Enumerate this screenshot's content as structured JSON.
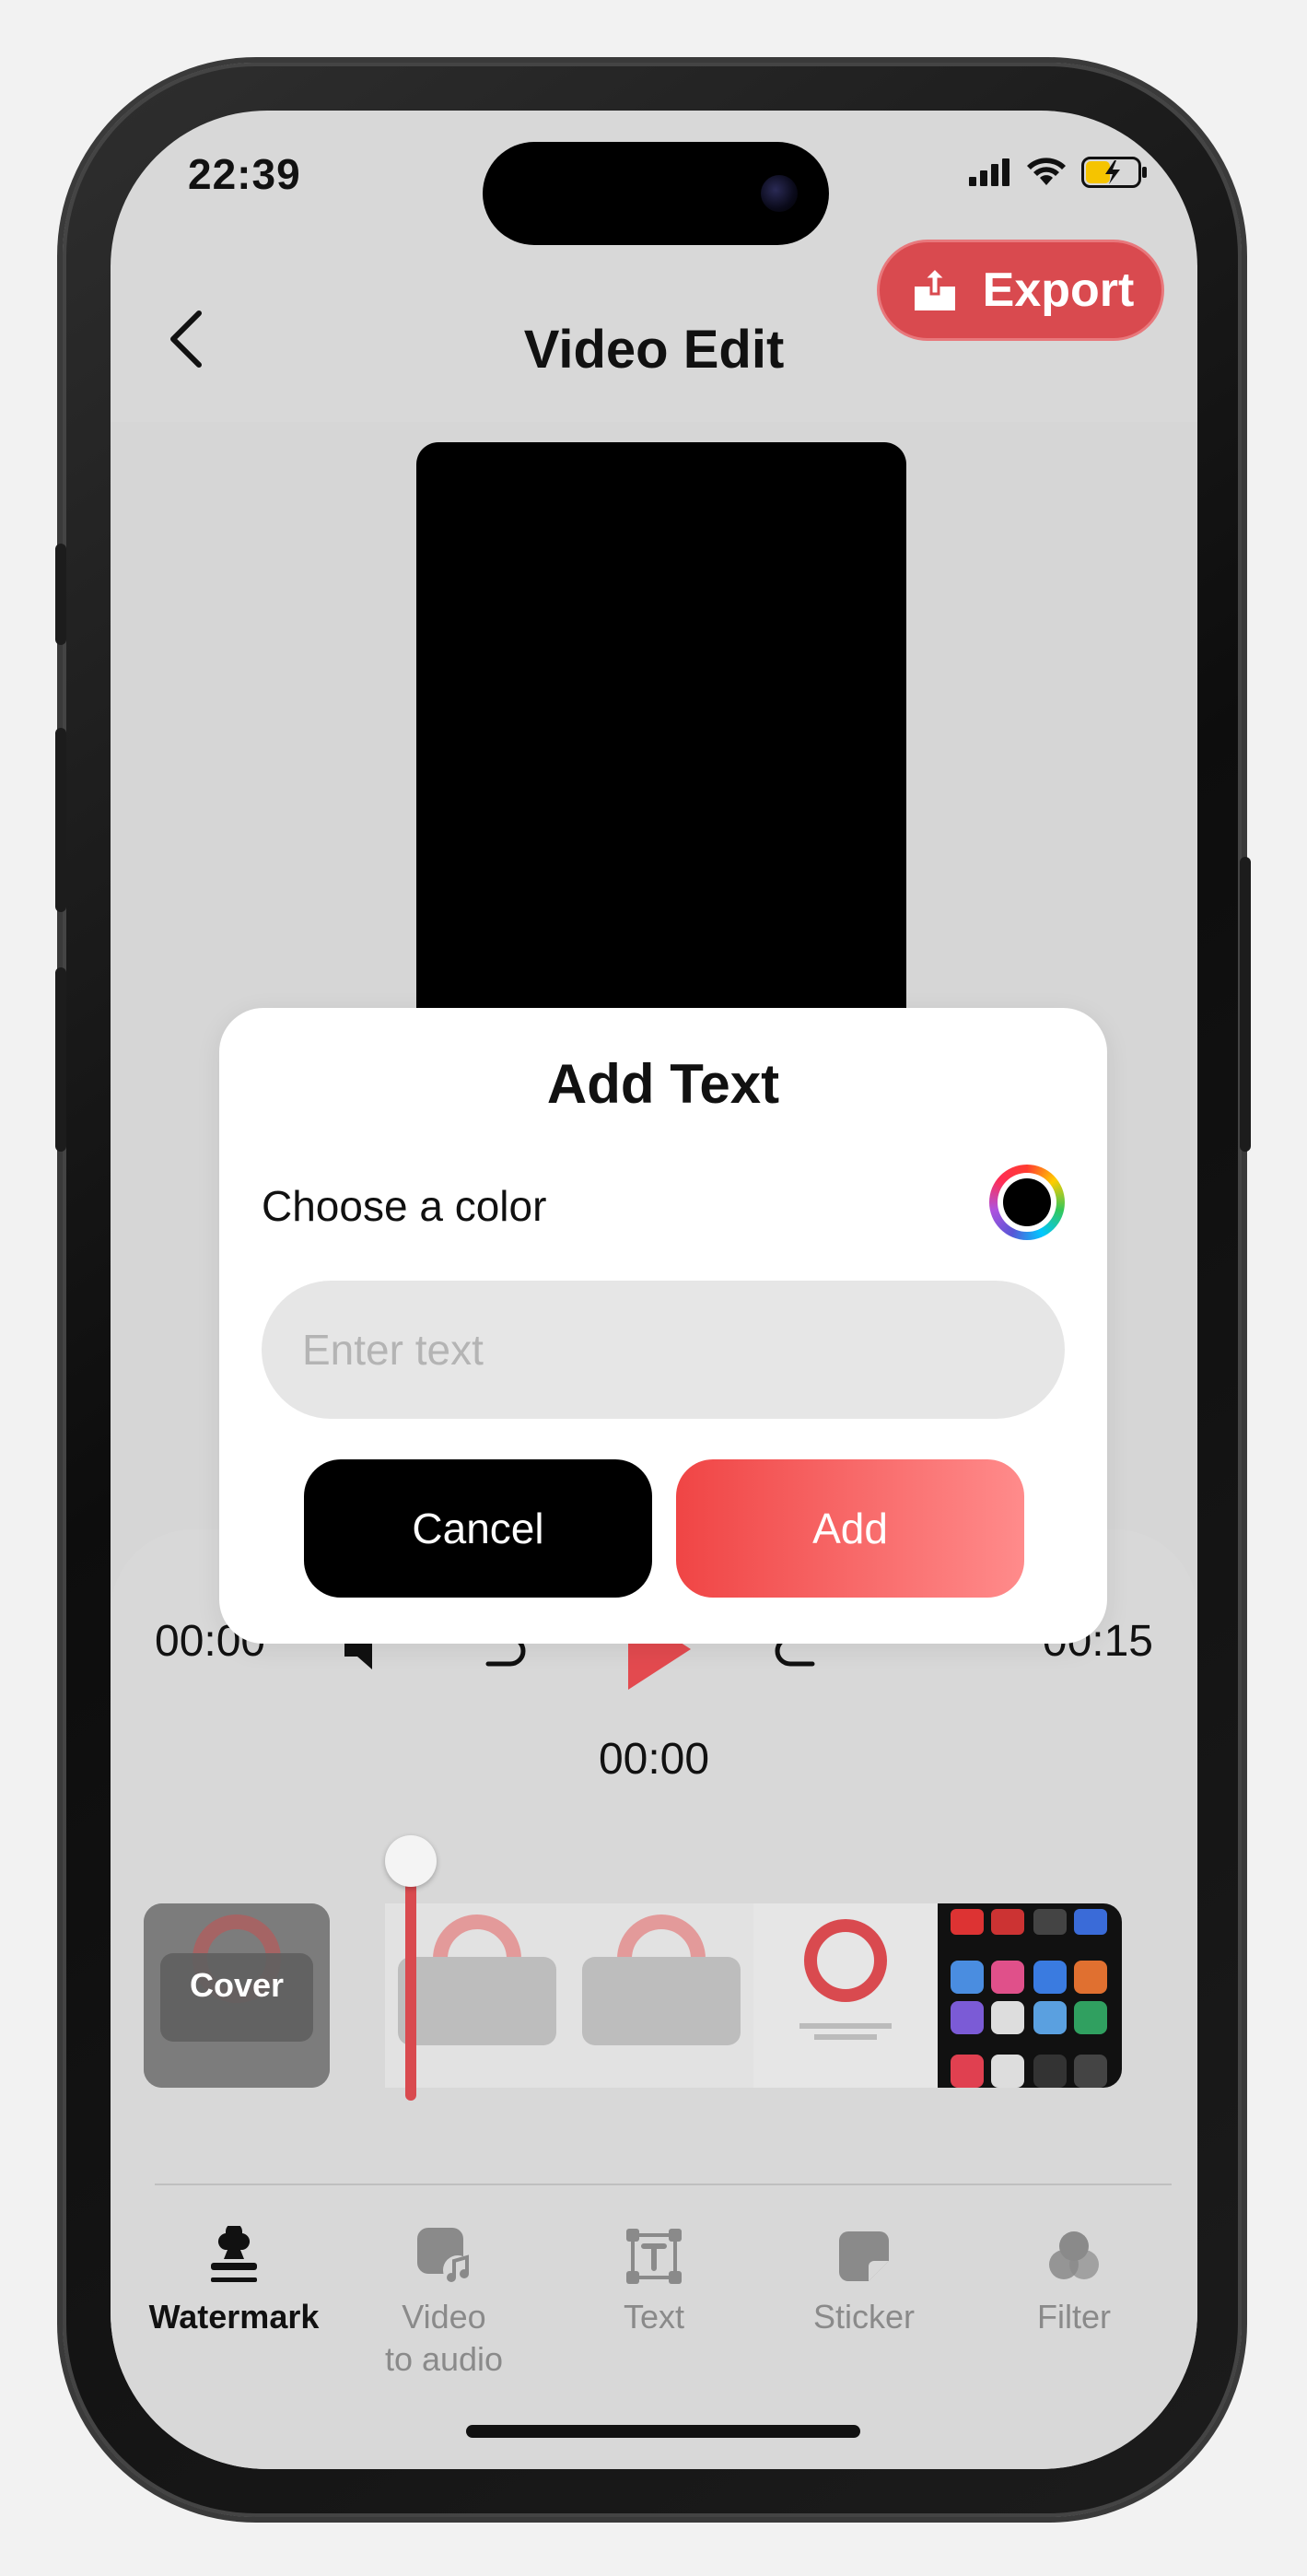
{
  "status_bar": {
    "time": "22:39"
  },
  "header": {
    "title": "Video Edit",
    "export_label": "Export"
  },
  "player": {
    "current_time": "00:00",
    "duration": "00:15",
    "playhead_time": "00:00"
  },
  "timeline": {
    "cover_label": "Cover"
  },
  "dialog": {
    "title": "Add Text",
    "color_label": "Choose a color",
    "selected_color": "#000000",
    "input_placeholder": "Enter text",
    "input_value": "",
    "cancel_label": "Cancel",
    "add_label": "Add"
  },
  "tabs": [
    {
      "label": "Watermark",
      "icon": "stamp-icon",
      "active": true
    },
    {
      "label": "Video\nto audio",
      "icon": "video-to-audio-icon",
      "active": false
    },
    {
      "label": "Text",
      "icon": "text-frame-icon",
      "active": false
    },
    {
      "label": "Sticker",
      "icon": "sticker-icon",
      "active": false
    },
    {
      "label": "Filter",
      "icon": "filter-icon",
      "active": false
    }
  ],
  "colors": {
    "accent": "#d94a4f",
    "add_gradient_start": "#f04545",
    "add_gradient_end": "#ff8b8b"
  }
}
